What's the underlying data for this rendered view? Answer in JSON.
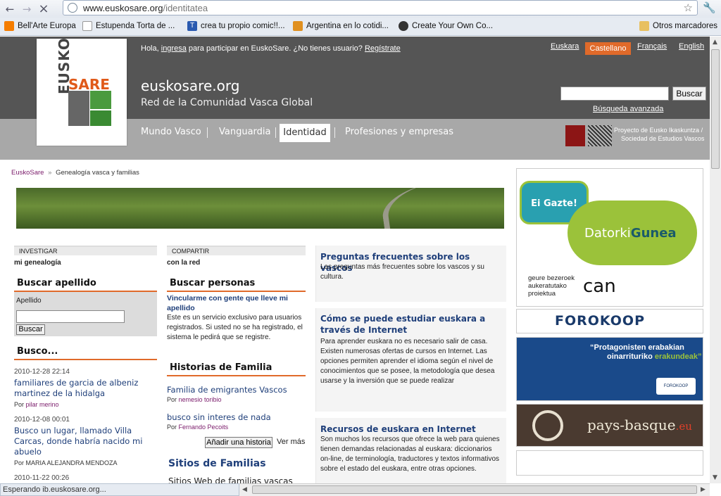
{
  "browser": {
    "url_domain": "www.euskosare.org",
    "url_path": "/identitatea"
  },
  "bookmarks": [
    {
      "label": "Bell'Arte Europa",
      "icon": "blogger-icon",
      "color": "#f57d00"
    },
    {
      "label": "Estupenda Torta de ...",
      "icon": "page-icon",
      "color": "#ffffff"
    },
    {
      "label": "crea tu propio comic!!...",
      "icon": "t-icon",
      "color": "#2a5ab0"
    },
    {
      "label": "Argentina en lo cotidi...",
      "icon": "map-icon",
      "color": "#e09020"
    },
    {
      "label": "Create Your Own Co...",
      "icon": "mask-icon",
      "color": "#333333"
    },
    {
      "label": "Otros marcadores",
      "icon": "folder-icon",
      "color": "#e8c060"
    }
  ],
  "header": {
    "greeting_pre": "Hola,",
    "greeting_login": "ingresa",
    "greeting_mid": "para participar en EuskoSare. ¿No tienes usuario?",
    "greeting_register": "Regístrate",
    "languages": [
      "Euskara",
      "Castellano",
      "Français",
      "English"
    ],
    "active_language": "Castellano",
    "site_title": "euskosare.org",
    "site_subtitle": "Red de la Comunidad Vasca Global",
    "search_button": "Buscar",
    "advanced_search": "Búsqueda avanzada",
    "logo_word1": "EUSKO",
    "logo_word2": "SARE",
    "partner_line1": "Proyecto de Eusko Ikaskuntza /",
    "partner_line2": "Sociedad de Estudios Vascos"
  },
  "tabs": [
    "Mundo Vasco",
    "Vanguardia",
    "Identidad",
    "Profesiones y empresas"
  ],
  "breadcrumb": {
    "home": "EuskoSare",
    "sep": "»",
    "current": "Genealogía vasca y familias"
  },
  "investigar": {
    "heading": "INVESTIGAR",
    "sub": "mi genealogía",
    "search_title": "Buscar apellido",
    "field_label": "Apellido",
    "button": "Buscar",
    "busco_title": "Busco...",
    "items": [
      {
        "date": "2010-12-28 22:14",
        "title": "familiares de garcia de albeniz martinez de la hidalga",
        "by": "Por",
        "name": "pilar merino"
      },
      {
        "date": "2010-12-08 00:01",
        "title": "Busco un lugar, llamado Villa Carcas, donde habría nacido mi abuelo",
        "by": "Por",
        "name": "MARIA ALEJANDRA MENDOZA"
      },
      {
        "date": "2010-11-22 00:26",
        "title": "",
        "by": "",
        "name": ""
      }
    ]
  },
  "compartir": {
    "heading": "COMPARTIR",
    "sub": "con la red",
    "people_title": "Buscar personas",
    "people_link": "Vincularme con gente que lleve mi apellido",
    "people_text": "Este es un servicio exclusivo para usuarios registrados. Si usted no se ha registrado, el sistema le pedirá que se registre.",
    "stories_title": "Historias de Familia",
    "stories": [
      {
        "title": "Familia de emigrantes Vascos",
        "by": "Por",
        "name": "nemesio toribio"
      },
      {
        "title": "busco sin interes de nada",
        "by": "Por",
        "name": "Fernando Pecoits"
      }
    ],
    "add_button": "Añadir una historia",
    "see_more": "Ver más",
    "sites_title": "Sitios de Familias",
    "sites_text": "Sitios Web de familias vascas"
  },
  "faq": [
    {
      "q": "Preguntas frecuentes sobre los vascos",
      "a": "Las preguntas más frecuentes sobre los vascos y su cultura."
    },
    {
      "q": "Cómo se puede estudiar euskara a través de Internet",
      "a": "Para aprender euskara no es necesario salir de casa. Existen numerosas ofertas de cursos en Internet. Las opciones permiten aprender el idioma según el nivel de conocimientos que se posee, la metodología que desea usarse y la inversión que se puede realizar"
    },
    {
      "q": "Recursos de euskara en Internet",
      "a": "Son muchos los recursos que ofrece la web para quienes tienen demandas relacionadas al euskara: diccionarios on-line, de terminología, traductores y textos informativos sobre el estado del euskara, entre otras opciones."
    }
  ],
  "ads": {
    "gazte_bubble": "Ei Gazte!",
    "gazte_word1": "Datorki",
    "gazte_word2": "Gunea",
    "can_line1": "geure bezeroek",
    "can_line2": "aukeratutako",
    "can_line3": "proiektua",
    "can_word": "can",
    "forokoop": "FOROKOOP",
    "protag_line1": "“Protagonisten erabakian",
    "protag_line2": "oinarrituriko",
    "protag_line3": "erakundeak”",
    "forokoop_small": "FOROKOOP",
    "paysbasque": "pays-basque",
    "paysbasque_tld": ".eu"
  },
  "status": "Esperando ib.euskosare.org..."
}
